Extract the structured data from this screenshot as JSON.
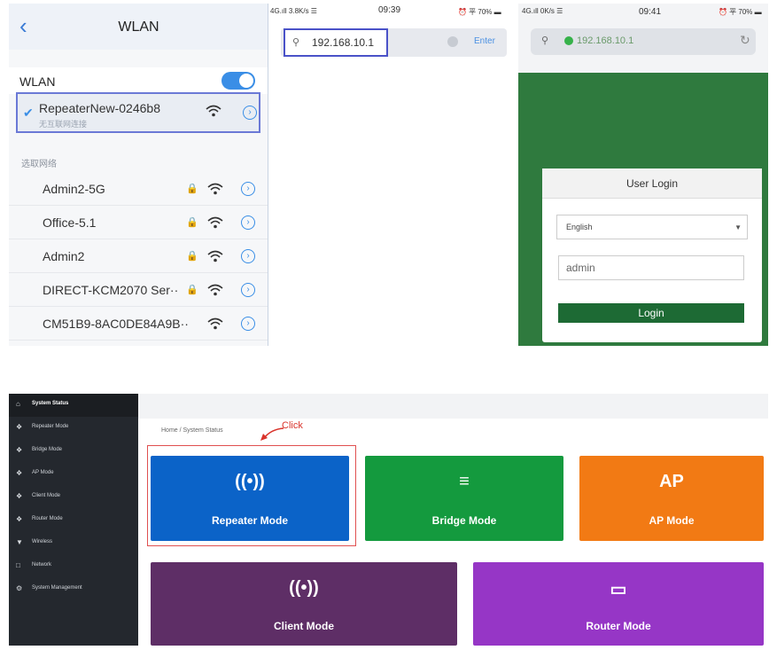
{
  "phone1": {
    "back_icon": "chevron-left-icon",
    "title": "WLAN",
    "wlan_label": "WLAN",
    "wlan_enabled": true,
    "connected": {
      "name": "RepeaterNew-0246b8",
      "status": "无互联网连接"
    },
    "section_label": "选取网络",
    "networks": [
      {
        "name": "Admin2-5G",
        "locked": true
      },
      {
        "name": "Office-5.1",
        "locked": true
      },
      {
        "name": "Admin2",
        "locked": true
      },
      {
        "name": "DIRECT-KCM2070 Ser··",
        "locked": true
      },
      {
        "name": "CM51B9-8AC0DE84A9B··",
        "locked": false
      }
    ],
    "lock_glyph": "🔒",
    "wifi_glyph": "▼",
    "info_glyph": "›"
  },
  "phone2": {
    "status_left": "4G.ıll 3.8K/s ☰",
    "status_time": "09:39",
    "status_right": "⏰ 平 70% ▬",
    "url": "192.168.10.1",
    "enter_label": "Enter"
  },
  "phone3": {
    "status_left": "4G.ıll 0K/s ☰",
    "status_time": "09:41",
    "status_right": "⏰ 平 70% ▬",
    "url": "192.168.10.1",
    "card_title": "User Login",
    "language": "English",
    "username": "admin",
    "login_label": "Login"
  },
  "admin": {
    "sidebar": [
      {
        "label": "System Status",
        "icon": "home-icon",
        "glyph": "⌂",
        "active": true
      },
      {
        "label": "Repeater Mode",
        "icon": "diamond-icon",
        "glyph": "❖"
      },
      {
        "label": "Bridge Mode",
        "icon": "diamond-icon",
        "glyph": "❖"
      },
      {
        "label": "AP Mode",
        "icon": "diamond-icon",
        "glyph": "❖"
      },
      {
        "label": "Client Mode",
        "icon": "diamond-icon",
        "glyph": "❖"
      },
      {
        "label": "Router Mode",
        "icon": "diamond-icon",
        "glyph": "❖"
      },
      {
        "label": "Wireless",
        "icon": "wifi-icon",
        "glyph": "▼"
      },
      {
        "label": "Network",
        "icon": "network-icon",
        "glyph": "□"
      },
      {
        "label": "System Management",
        "icon": "gear-icon",
        "glyph": "⚙"
      }
    ],
    "breadcrumb": "Home / System Status",
    "click_label": "Click",
    "tiles": [
      {
        "label": "Repeater Mode",
        "icon_text": "((•))",
        "color": "#0b63c8"
      },
      {
        "label": "Bridge Mode",
        "icon_text": "≡",
        "color": "#149a3e"
      },
      {
        "label": "AP Mode",
        "icon_text": "AP",
        "color": "#f27a14"
      },
      {
        "label": "Client Mode",
        "icon_text": "((•))",
        "color": "#5e2e66"
      },
      {
        "label": "Router Mode",
        "icon_text": "▭",
        "color": "#9636c6"
      }
    ]
  }
}
